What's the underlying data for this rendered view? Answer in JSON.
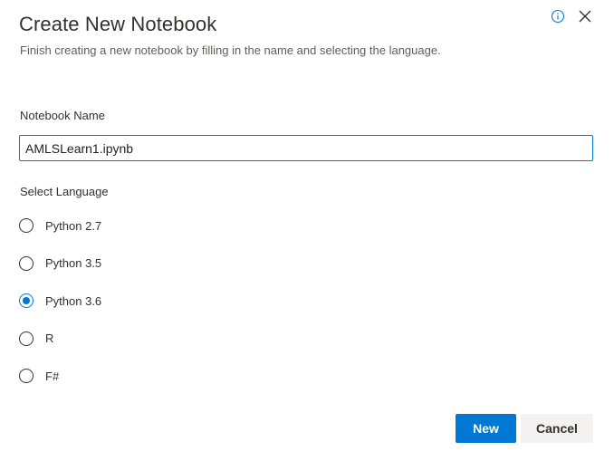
{
  "dialog": {
    "title": "Create New Notebook",
    "subtitle": "Finish creating a new notebook by filling in the name and selecting the language."
  },
  "icons": {
    "info": "info-icon",
    "close": "close-icon"
  },
  "notebook_name": {
    "label": "Notebook Name",
    "value": "AMLSLearn1.ipynb"
  },
  "language": {
    "label": "Select Language",
    "selected": "Python 3.6",
    "options": [
      {
        "label": "Python 2.7"
      },
      {
        "label": "Python 3.5"
      },
      {
        "label": "Python 3.6"
      },
      {
        "label": "R"
      },
      {
        "label": "F#"
      }
    ]
  },
  "buttons": {
    "new_label": "New",
    "cancel_label": "Cancel"
  },
  "colors": {
    "accent": "#0078d4",
    "text": "#323130",
    "subtext": "#605e5c",
    "secondary_button_bg": "#f3f2f1"
  }
}
